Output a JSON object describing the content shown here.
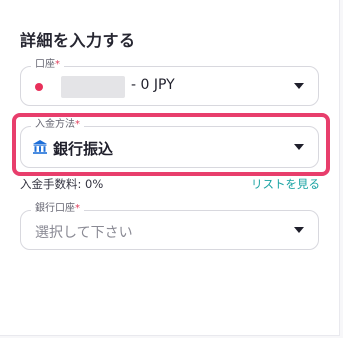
{
  "form": {
    "title": "詳細を入力する",
    "account": {
      "label": "口座",
      "required_mark": "*",
      "value": "- 0 JPY",
      "dot_color": "#e8305a"
    },
    "deposit_method": {
      "label": "入金方法",
      "required_mark": "*",
      "value": "銀行振込",
      "icon": "bank-icon",
      "highlight_color": "#e83e6c"
    },
    "fee": {
      "text": "入金手数料: 0%",
      "link": "リストを見る"
    },
    "bank_account": {
      "label": "銀行口座",
      "required_mark": "*",
      "placeholder": "選択して下さい"
    }
  }
}
